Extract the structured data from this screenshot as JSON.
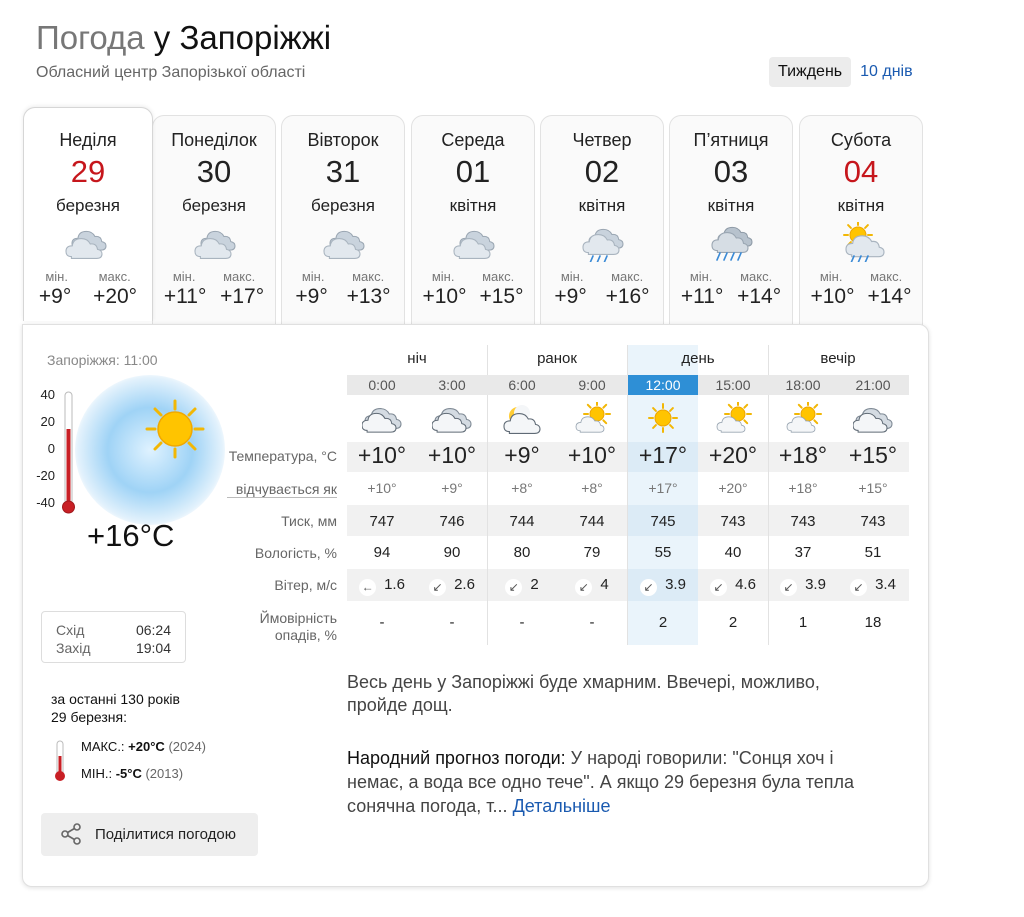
{
  "header": {
    "title_prefix": "Погода",
    "title_city": "у Запоріжжі",
    "subtitle": "Обласний центр Запорізької області",
    "view_week": "Тиждень",
    "view_10days": "10 днів"
  },
  "days": [
    {
      "name": "Неділя",
      "num": "29",
      "month": "березня",
      "min_label": "мін.",
      "max_label": "макс.",
      "min": "+9°",
      "max": "+20°",
      "icon": "cloudy-icon",
      "weekend": true
    },
    {
      "name": "Понеділок",
      "num": "30",
      "month": "березня",
      "min_label": "мін.",
      "max_label": "макс.",
      "min": "+11°",
      "max": "+17°",
      "icon": "cloudy-icon",
      "weekend": false
    },
    {
      "name": "Вівторок",
      "num": "31",
      "month": "березня",
      "min_label": "мін.",
      "max_label": "макс.",
      "min": "+9°",
      "max": "+13°",
      "icon": "cloudy-icon",
      "weekend": false
    },
    {
      "name": "Середа",
      "num": "01",
      "month": "квітня",
      "min_label": "мін.",
      "max_label": "макс.",
      "min": "+10°",
      "max": "+15°",
      "icon": "cloudy-icon",
      "weekend": false
    },
    {
      "name": "Четвер",
      "num": "02",
      "month": "квітня",
      "min_label": "мін.",
      "max_label": "макс.",
      "min": "+9°",
      "max": "+16°",
      "icon": "light-rain-icon",
      "weekend": false
    },
    {
      "name": "П’ятниця",
      "num": "03",
      "month": "квітня",
      "min_label": "мін.",
      "max_label": "макс.",
      "min": "+11°",
      "max": "+14°",
      "icon": "rain-icon",
      "weekend": false
    },
    {
      "name": "Субота",
      "num": "04",
      "month": "квітня",
      "min_label": "мін.",
      "max_label": "макс.",
      "min": "+10°",
      "max": "+14°",
      "icon": "sun-cloud-rain-icon",
      "weekend": true
    }
  ],
  "current": {
    "place_time": "Запоріжжя: 11:00",
    "temp": "+16°C",
    "scale": [
      "40",
      "20",
      "0",
      "-20",
      "-40"
    ],
    "sunrise_label": "Схід",
    "sunrise": "06:24",
    "sunset_label": "Захід",
    "sunset": "19:04"
  },
  "history": {
    "title_line1": "за останні 130 років",
    "title_line2": "29 березня:",
    "max_label": "МАКС.:",
    "max_val": "+20°C",
    "max_year": "(2024)",
    "min_label": "МІН.:",
    "min_val": "-5°C",
    "min_year": "(2013)"
  },
  "share": {
    "label": "Поділитися погодою"
  },
  "periods": [
    "ніч",
    "ранок",
    "день",
    "вечір"
  ],
  "row_labels": {
    "temp": "Температура, °C",
    "feels": "відчувається як",
    "pressure": "Тиск, мм",
    "humidity": "Вологість, %",
    "wind": "Вітер, м/с",
    "precip_1": "Ймовірність",
    "precip_2": "опадів, %"
  },
  "hours": [
    {
      "time": "0:00",
      "icon": "night-cloudy-icon",
      "temp": "+10°",
      "feels": "+10°",
      "pressure": "747",
      "humidity": "94",
      "wind_dir": "←",
      "wind": "1.6",
      "precip": "-"
    },
    {
      "time": "3:00",
      "icon": "night-cloudy-icon",
      "temp": "+10°",
      "feels": "+9°",
      "pressure": "746",
      "humidity": "90",
      "wind_dir": "↙",
      "wind": "2.6",
      "precip": "-"
    },
    {
      "time": "6:00",
      "icon": "night-moon-cloud-icon",
      "temp": "+9°",
      "feels": "+8°",
      "pressure": "744",
      "humidity": "80",
      "wind_dir": "↙",
      "wind": "2",
      "precip": "-"
    },
    {
      "time": "9:00",
      "icon": "sun-cloud-icon",
      "temp": "+10°",
      "feels": "+8°",
      "pressure": "744",
      "humidity": "79",
      "wind_dir": "↙",
      "wind": "4",
      "precip": "-"
    },
    {
      "time": "12:00",
      "icon": "sun-icon",
      "temp": "+17°",
      "feels": "+17°",
      "pressure": "745",
      "humidity": "55",
      "wind_dir": "↙",
      "wind": "3.9",
      "precip": "2"
    },
    {
      "time": "15:00",
      "icon": "sun-cloud-icon",
      "temp": "+20°",
      "feels": "+20°",
      "pressure": "743",
      "humidity": "40",
      "wind_dir": "↙",
      "wind": "4.6",
      "precip": "2"
    },
    {
      "time": "18:00",
      "icon": "sun-cloud-icon",
      "temp": "+18°",
      "feels": "+18°",
      "pressure": "743",
      "humidity": "37",
      "wind_dir": "↙",
      "wind": "3.9",
      "precip": "1"
    },
    {
      "time": "21:00",
      "icon": "night-cloudy-icon",
      "temp": "+15°",
      "feels": "+15°",
      "pressure": "743",
      "humidity": "51",
      "wind_dir": "↙",
      "wind": "3.4",
      "precip": "18"
    }
  ],
  "description": "Весь день у Запоріжжі буде хмарним. Ввечері, можливо, пройде дощ.",
  "folk": {
    "label": "Народний прогноз погоди:",
    "text": " У народі говорили: \"Сонця хоч і немає, а вода все одно тече\". А якщо 29 березня була тепла сонячна погода, т...",
    "more": "Детальніше"
  }
}
